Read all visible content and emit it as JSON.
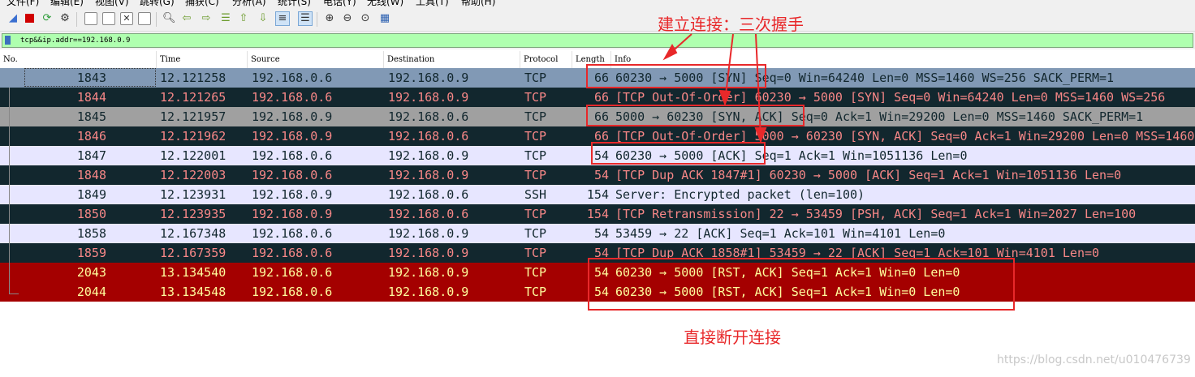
{
  "menu": [
    "文件(F)",
    "编辑(E)",
    "视图(V)",
    "跳转(G)",
    "捕获(C)",
    "分析(A)",
    "统计(S)",
    "电话(Y)",
    "无线(W)",
    "工具(T)",
    "帮助(H)"
  ],
  "toolbar_icons": [
    "shark-fin-start-icon",
    "stop-icon",
    "restart-icon",
    "options-gear-icon",
    "open-file-icon",
    "save-file-icon",
    "close-file-icon",
    "reload-icon",
    "find-icon",
    "go-back-icon",
    "go-forward-icon",
    "go-to-packet-icon",
    "go-first-icon",
    "go-last-icon",
    "auto-scroll-icon",
    "colorize-icon",
    "zoom-in-icon",
    "zoom-out-icon",
    "zoom-normal-icon",
    "resize-columns-icon"
  ],
  "filter": {
    "value": "tcp&&ip.addr==192.168.0.9"
  },
  "columns": [
    "No.",
    "Time",
    "Source",
    "Destination",
    "Protocol",
    "Length",
    "Info"
  ],
  "packets": [
    {
      "no": "1843",
      "time": "12.121258",
      "src": "192.168.0.6",
      "dst": "192.168.0.9",
      "proto": "TCP",
      "len": "66",
      "info": "60230 → 5000 [SYN] Seq=0 Win=64240 Len=0 MSS=1460 WS=256 SACK_PERM=1",
      "bg": "#8199b5",
      "fg": "#12272e",
      "selected": true
    },
    {
      "no": "1844",
      "time": "12.121265",
      "src": "192.168.0.6",
      "dst": "192.168.0.9",
      "proto": "TCP",
      "len": "66",
      "info": "[TCP Out-Of-Order] 60230 → 5000 [SYN] Seq=0 Win=64240 Len=0 MSS=1460 WS=256",
      "bg": "#12272e",
      "fg": "#f78787"
    },
    {
      "no": "1845",
      "time": "12.121957",
      "src": "192.168.0.9",
      "dst": "192.168.0.6",
      "proto": "TCP",
      "len": "66",
      "info": "5000 → 60230 [SYN, ACK] Seq=0 Ack=1 Win=29200 Len=0 MSS=1460 SACK_PERM=1",
      "bg": "#a0a0a0",
      "fg": "#12272e"
    },
    {
      "no": "1846",
      "time": "12.121962",
      "src": "192.168.0.9",
      "dst": "192.168.0.6",
      "proto": "TCP",
      "len": "66",
      "info": "[TCP Out-Of-Order] 5000 → 60230 [SYN, ACK] Seq=0 Ack=1 Win=29200 Len=0 MSS=1460",
      "bg": "#12272e",
      "fg": "#f78787"
    },
    {
      "no": "1847",
      "time": "12.122001",
      "src": "192.168.0.6",
      "dst": "192.168.0.9",
      "proto": "TCP",
      "len": "54",
      "info": "60230 → 5000 [ACK] Seq=1 Ack=1 Win=1051136 Len=0",
      "bg": "#e7e6ff",
      "fg": "#12272e"
    },
    {
      "no": "1848",
      "time": "12.122003",
      "src": "192.168.0.6",
      "dst": "192.168.0.9",
      "proto": "TCP",
      "len": "54",
      "info": "[TCP Dup ACK 1847#1] 60230 → 5000 [ACK] Seq=1 Ack=1 Win=1051136 Len=0",
      "bg": "#12272e",
      "fg": "#f78787"
    },
    {
      "no": "1849",
      "time": "12.123931",
      "src": "192.168.0.9",
      "dst": "192.168.0.6",
      "proto": "SSH",
      "len": "154",
      "info": "Server: Encrypted packet (len=100)",
      "bg": "#e7e6ff",
      "fg": "#12272e"
    },
    {
      "no": "1850",
      "time": "12.123935",
      "src": "192.168.0.9",
      "dst": "192.168.0.6",
      "proto": "TCP",
      "len": "154",
      "info": "[TCP Retransmission] 22 → 53459 [PSH, ACK] Seq=1 Ack=1 Win=2027 Len=100",
      "bg": "#12272e",
      "fg": "#f78787"
    },
    {
      "no": "1858",
      "time": "12.167348",
      "src": "192.168.0.6",
      "dst": "192.168.0.9",
      "proto": "TCP",
      "len": "54",
      "info": "53459 → 22 [ACK] Seq=1 Ack=101 Win=4101 Len=0",
      "bg": "#e7e6ff",
      "fg": "#12272e"
    },
    {
      "no": "1859",
      "time": "12.167359",
      "src": "192.168.0.6",
      "dst": "192.168.0.9",
      "proto": "TCP",
      "len": "54",
      "info": "[TCP Dup ACK 1858#1] 53459 → 22 [ACK] Seq=1 Ack=101 Win=4101 Len=0",
      "bg": "#12272e",
      "fg": "#f78787"
    },
    {
      "no": "2043",
      "time": "13.134540",
      "src": "192.168.0.6",
      "dst": "192.168.0.9",
      "proto": "TCP",
      "len": "54",
      "info": "60230 → 5000 [RST, ACK] Seq=1 Ack=1 Win=0 Len=0",
      "bg": "#a40000",
      "fg": "#fffc9c"
    },
    {
      "no": "2044",
      "time": "13.134548",
      "src": "192.168.0.6",
      "dst": "192.168.0.9",
      "proto": "TCP",
      "len": "54",
      "info": "60230 → 5000 [RST, ACK] Seq=1 Ack=1 Win=0 Len=0",
      "bg": "#a40000",
      "fg": "#fffc9c"
    }
  ],
  "annotations": {
    "handshake": "建立连接：三次握手",
    "reset": "直接断开连接",
    "color": "#e8282a"
  },
  "watermark": "https://blog.csdn.net/u010476739"
}
